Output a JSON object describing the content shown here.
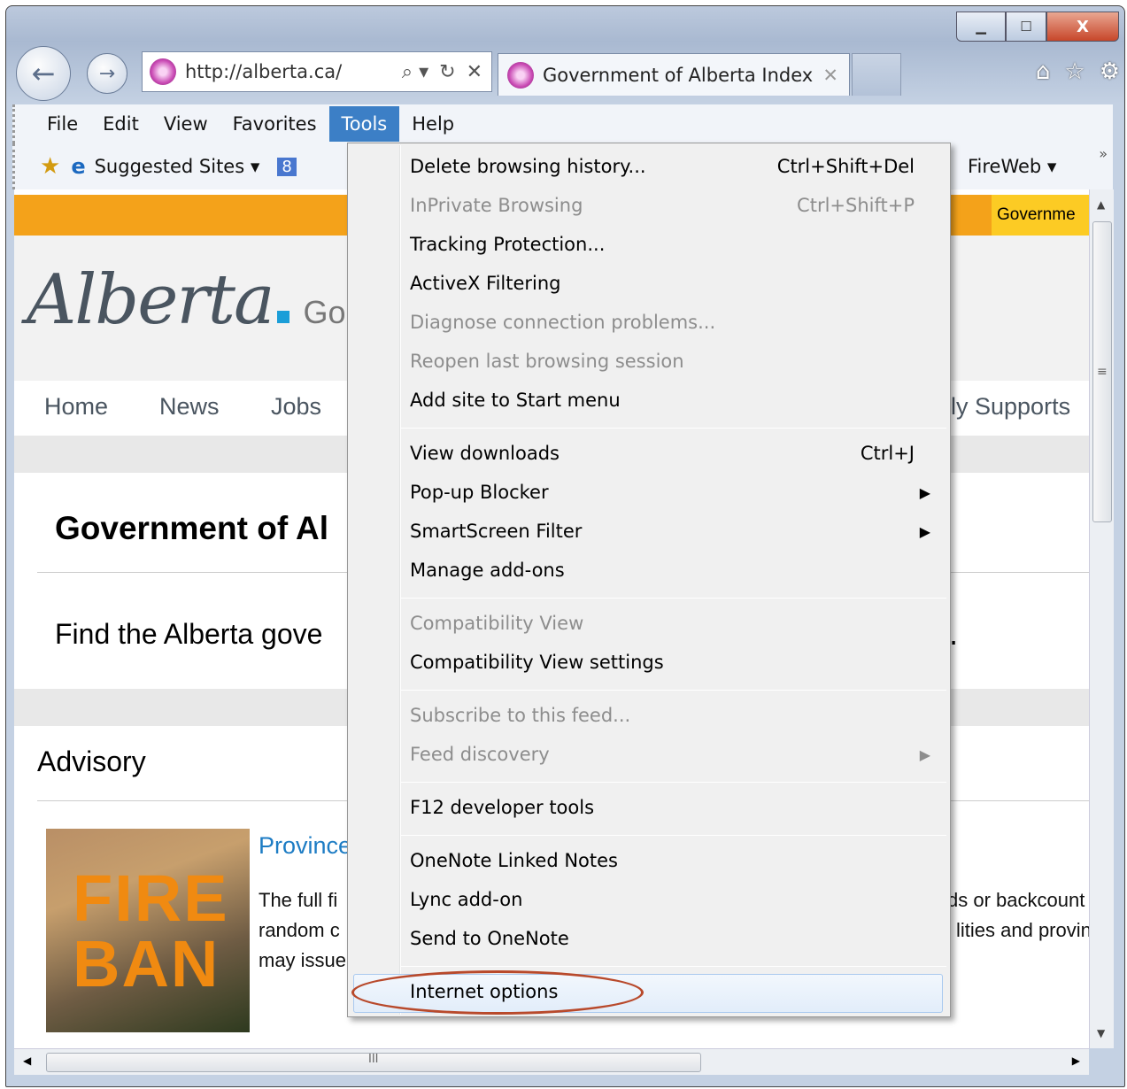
{
  "browser": {
    "url": "http://alberta.ca/",
    "tab_title": "Government of Alberta Index",
    "back_glyph": "←",
    "forward_glyph": "→",
    "search_glyph": "⌕ ▾",
    "refresh_glyph": "↻",
    "stop_glyph": "✕",
    "tab_close": "✕",
    "min_glyph": "▁",
    "max_glyph": "☐",
    "close_glyph": "X",
    "home_glyph": "⌂",
    "fav_glyph": "☆",
    "gear_glyph": "⚙"
  },
  "menubar": {
    "items": [
      "File",
      "Edit",
      "View",
      "Favorites",
      "Tools",
      "Help"
    ],
    "active": "Tools"
  },
  "favbar": {
    "suggested": "Suggested Sites ▾",
    "g8": "8",
    "fireweb": "FireWeb ▾",
    "chevron": "»"
  },
  "page": {
    "top_link": "Governme",
    "logo_script": "Alberta",
    "logo_go": "Go",
    "nav": [
      "Home",
      "News",
      "Jobs",
      "ily Supports"
    ],
    "heading": "Government of Al",
    "find_text": "Find the Alberta gove",
    "find_end": ".",
    "advisory": "Advisory",
    "fire1": "FIRE",
    "fire2": "BAN",
    "province": "Province",
    "lines_left": [
      "The full fi",
      "random c",
      "may issue"
    ],
    "lines_right": [
      "ds or backcount",
      "lities and provin"
    ]
  },
  "tools_menu": {
    "groups": [
      [
        {
          "label": "Delete browsing history...",
          "shortcut": "Ctrl+Shift+Del",
          "enabled": true
        },
        {
          "label": "InPrivate Browsing",
          "shortcut": "Ctrl+Shift+P",
          "enabled": false
        },
        {
          "label": "Tracking Protection...",
          "shortcut": "",
          "enabled": true
        },
        {
          "label": "ActiveX Filtering",
          "shortcut": "",
          "enabled": true
        },
        {
          "label": "Diagnose connection problems...",
          "shortcut": "",
          "enabled": false
        },
        {
          "label": "Reopen last browsing session",
          "shortcut": "",
          "enabled": false
        },
        {
          "label": "Add site to Start menu",
          "shortcut": "",
          "enabled": true
        }
      ],
      [
        {
          "label": "View downloads",
          "shortcut": "Ctrl+J",
          "enabled": true
        },
        {
          "label": "Pop-up Blocker",
          "submenu": true,
          "enabled": true
        },
        {
          "label": "SmartScreen Filter",
          "submenu": true,
          "enabled": true
        },
        {
          "label": "Manage add-ons",
          "shortcut": "",
          "enabled": true
        }
      ],
      [
        {
          "label": "Compatibility View",
          "shortcut": "",
          "enabled": false
        },
        {
          "label": "Compatibility View settings",
          "shortcut": "",
          "enabled": true
        }
      ],
      [
        {
          "label": "Subscribe to this feed...",
          "shortcut": "",
          "enabled": false
        },
        {
          "label": "Feed discovery",
          "submenu": true,
          "enabled": false
        }
      ],
      [
        {
          "label": "F12 developer tools",
          "shortcut": "",
          "enabled": true
        }
      ],
      [
        {
          "label": "OneNote Linked Notes",
          "shortcut": "",
          "enabled": true
        },
        {
          "label": "Lync add-on",
          "shortcut": "",
          "enabled": true
        },
        {
          "label": "Send to OneNote",
          "shortcut": "",
          "enabled": true
        }
      ],
      [
        {
          "label": "Internet options",
          "shortcut": "",
          "enabled": true,
          "highlighted": true
        }
      ]
    ],
    "submenu_glyph": "▶",
    "highlight_ring_color": "#b8492b"
  },
  "scroll": {
    "grip": "≡",
    "hgrip": "III",
    "up": "▲",
    "down": "▼",
    "left": "◀",
    "right": "▶"
  }
}
